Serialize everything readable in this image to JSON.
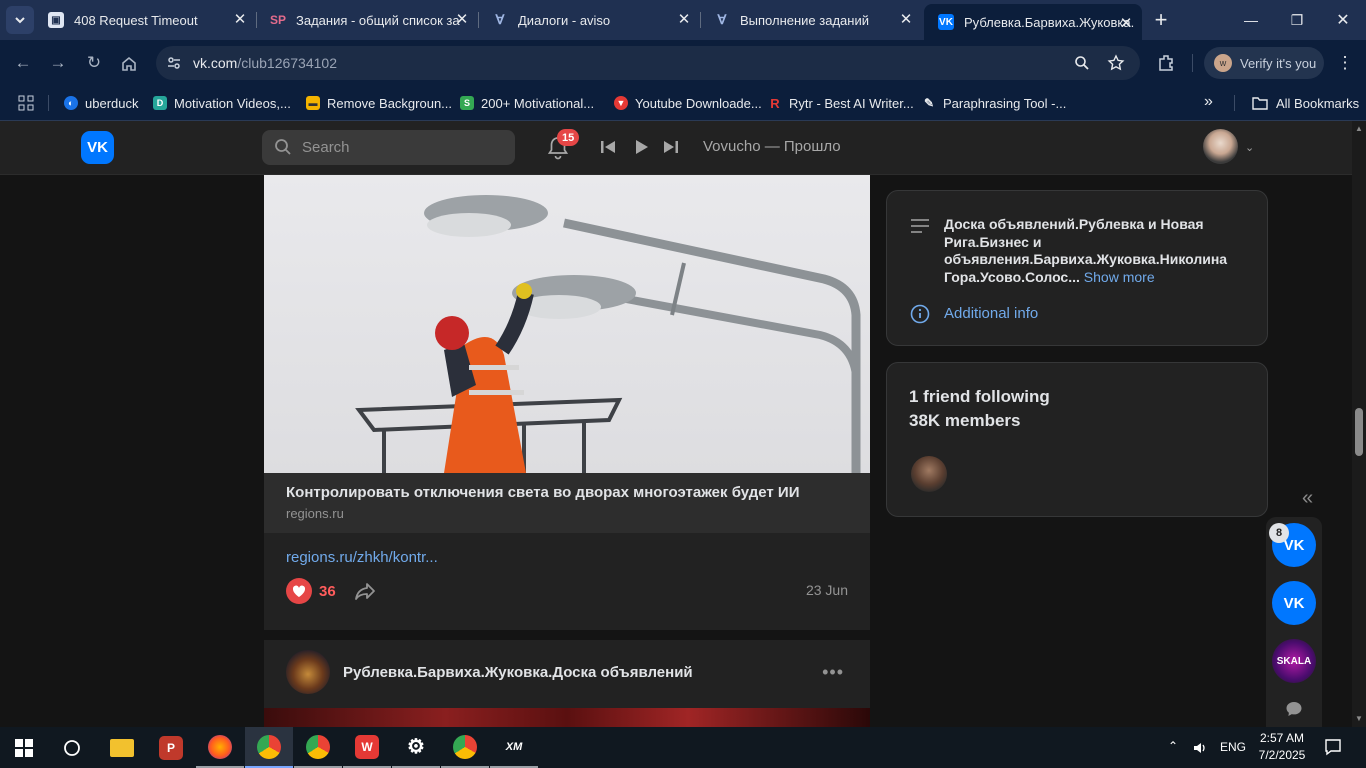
{
  "browser": {
    "tabs": [
      {
        "title": "408 Request Timeout",
        "favicon": "page-icon"
      },
      {
        "title": "Задания - общий список за",
        "favicon": "sp-icon"
      },
      {
        "title": "Диалоги - aviso",
        "favicon": "aviso-icon"
      },
      {
        "title": "Выполнение заданий",
        "favicon": "aviso-icon"
      },
      {
        "title": "Рублевка.Барвиха.Жуковка.",
        "favicon": "vk-icon"
      }
    ],
    "url_host": "vk.com",
    "url_path": "/club126734102",
    "verify_label": "Verify it's you",
    "verify_avatar": "w",
    "bookmarks": [
      {
        "label": "uberduck",
        "color": "#1a73e8"
      },
      {
        "label": "Motivation Videos,...",
        "color": "#26a69a"
      },
      {
        "label": "Remove Backgroun...",
        "color": "#f4b400"
      },
      {
        "label": "200+ Motivational...",
        "color": "#34a853"
      },
      {
        "label": "Youtube Downloade...",
        "color": "#e53935"
      },
      {
        "label": "Rytr - Best AI Writer...",
        "color": "#e53935"
      },
      {
        "label": "Paraphrasing Tool -...",
        "color": "#9e9e9e"
      }
    ],
    "all_bookmarks_label": "All Bookmarks"
  },
  "vk": {
    "search_placeholder": "Search",
    "notification_count": "15",
    "now_playing": "Vovucho — Прошло",
    "accent": "#0077ff"
  },
  "post": {
    "snippet_title": "Контролировать отключения света во дворах многоэтажек будет ИИ",
    "snippet_source": "regions.ru",
    "link_text": "regions.ru/zhkh/kontr...",
    "like_count": "36",
    "date": "23 Jun"
  },
  "next_post": {
    "group_name": "Рублевка.Барвиха.Жуковка.Доска объявлений",
    "more_glyph": "•••"
  },
  "sidebar": {
    "description": "Доска объявлений.Рублевка и Новая Рига.Бизнес и объявления.Барвиха.Жуковка.Николина Гора.Усово.Солос...",
    "show_more": "Show more",
    "additional_info": "Additional info",
    "friends_following": "1 friend following",
    "members": "38K members"
  },
  "chat_dock": {
    "unread_badge": "8",
    "chats": [
      {
        "label": "VK",
        "icon": "vk-icon"
      },
      {
        "label": "VK",
        "icon": "vk-icon"
      },
      {
        "label": "SKALA",
        "icon": "skala-icon"
      }
    ]
  },
  "taskbar": {
    "language": "ENG",
    "time": "2:57 AM",
    "date": "7/2/2025",
    "apps": [
      "windows-start-icon",
      "search-icon",
      "file-explorer-icon",
      "psiphon-icon",
      "firefox-icon",
      "chrome-icon",
      "chrome-icon",
      "wps-office-icon",
      "settings-icon",
      "chrome-icon",
      "xm-icon"
    ]
  }
}
